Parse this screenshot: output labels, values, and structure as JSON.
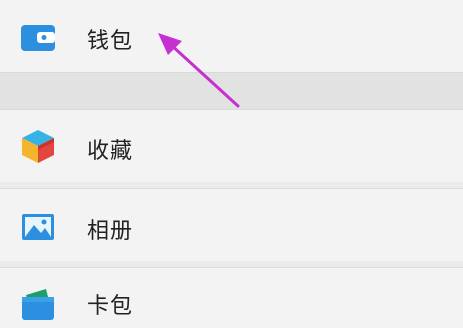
{
  "menu": {
    "items": [
      {
        "label": "钱包",
        "icon": "wallet-icon"
      },
      {
        "label": "收藏",
        "icon": "cube-icon"
      },
      {
        "label": "相册",
        "icon": "photo-icon"
      },
      {
        "label": "卡包",
        "icon": "card-icon"
      }
    ]
  },
  "annotation": {
    "icon": "arrow-icon",
    "color": "#c62fd1"
  },
  "colors": {
    "accent_blue": "#2d8fe0",
    "row_background": "#f3f3f3",
    "gap_background": "#e2e2e2"
  }
}
